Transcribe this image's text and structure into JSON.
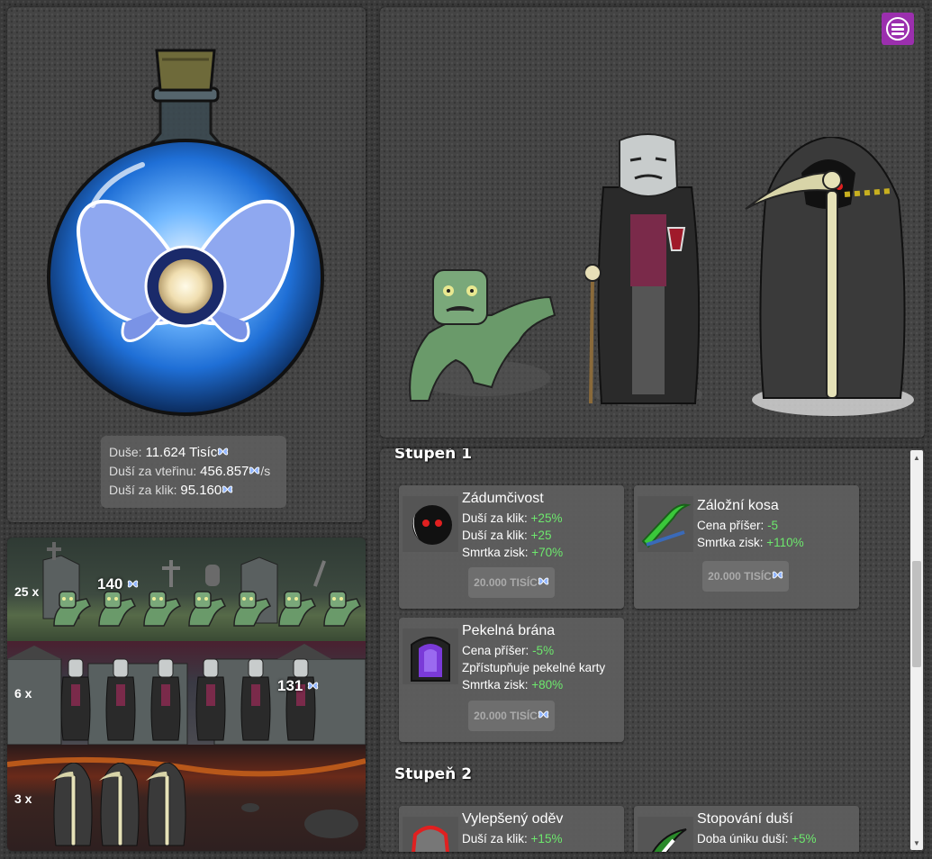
{
  "stats": {
    "souls_label": "Duše:",
    "souls_value": "11.624 Tisíc",
    "per_second_label": "Duší za vteřinu:",
    "per_second_value": "456.857",
    "per_second_unit": "/s",
    "per_click_label": "Duší za klik:",
    "per_click_value": "95.160"
  },
  "graveyard": {
    "rows": [
      {
        "count": "25 x",
        "floating": "140"
      },
      {
        "count": "6 x",
        "floating": "131"
      },
      {
        "count": "3 x",
        "floating": ""
      }
    ]
  },
  "upgrades": {
    "tier1": "Stupeň 1",
    "tier2": "Stupeň 2",
    "cards": [
      {
        "title": "Zádumčivost",
        "lines": [
          {
            "label": "Duší za klik:",
            "value": "+25%"
          },
          {
            "label": "Duší za klik:",
            "value": "+25"
          },
          {
            "label": "Smrtka zisk:",
            "value": "+70%"
          }
        ],
        "price": "20.000 TISÍC"
      },
      {
        "title": "Záložní kosa",
        "lines": [
          {
            "label": "Cena příšer:",
            "value": "-5"
          },
          {
            "label": "Smrtka zisk:",
            "value": "+110%"
          }
        ],
        "price": "20.000 TISÍC"
      },
      {
        "title": "Pekelná brána",
        "lines": [
          {
            "label": "Cena příšer:",
            "value": "-5%"
          },
          {
            "label": "Zpřístupňuje pekelné karty",
            "value": ""
          },
          {
            "label": "Smrtka zisk:",
            "value": "+80%"
          }
        ],
        "price": "20.000 TISÍC"
      },
      {
        "title": "Vylepšený oděv",
        "lines": [
          {
            "label": "Duší za klik:",
            "value": "+15%"
          }
        ],
        "price": ""
      },
      {
        "title": "Stopování duší",
        "lines": [
          {
            "label": "Doba úniku duší:",
            "value": "+5%"
          }
        ],
        "price": ""
      }
    ]
  },
  "colors": {
    "menu": "#9b2fae",
    "bonus": "#6de86d",
    "soul": "#8fb4ff"
  }
}
